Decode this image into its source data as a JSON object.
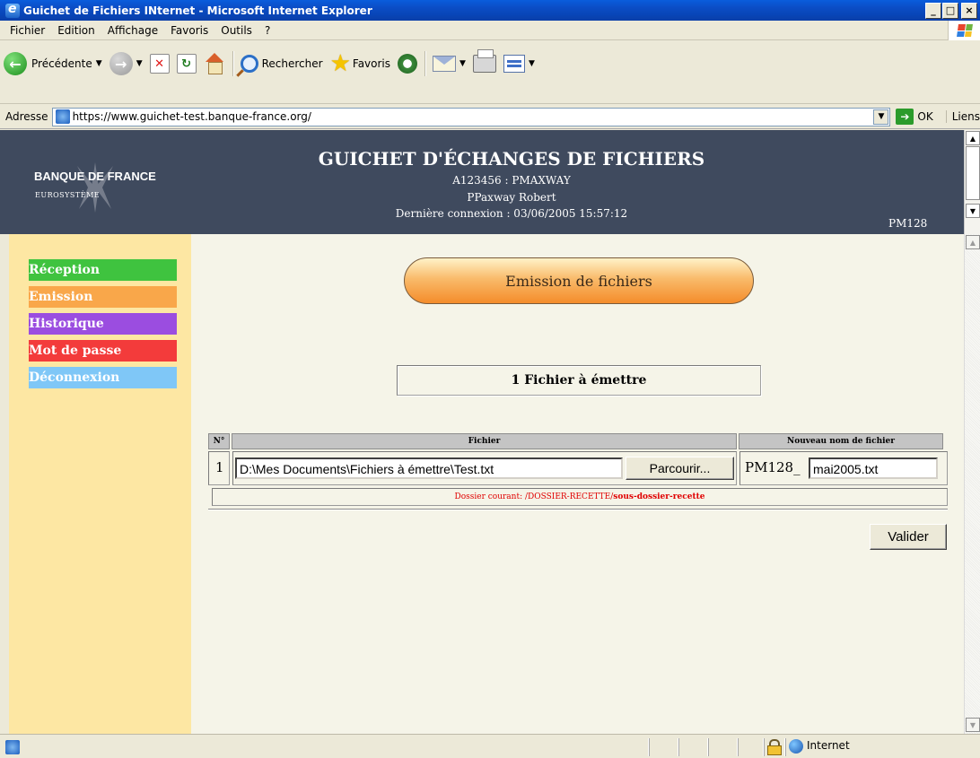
{
  "window": {
    "title": "Guichet de Fichiers INternet - Microsoft Internet Explorer",
    "buttons": {
      "minimize": "_",
      "maximize": "□",
      "close": "×"
    }
  },
  "menu": [
    "Fichier",
    "Edition",
    "Affichage",
    "Favoris",
    "Outils",
    "?"
  ],
  "toolbar": {
    "back_label": "Précédente",
    "search_label": "Rechercher",
    "favorites_label": "Favoris"
  },
  "address": {
    "label": "Adresse",
    "url": "https://www.guichet-test.banque-france.org/",
    "go_label": "OK",
    "links_label": "Liens"
  },
  "header": {
    "logo_name": "BANQUE DE FRANCE",
    "logo_sub": "EUROSYSTÈME",
    "title": "GUICHET D'ÉCHANGES DE FICHIERS",
    "user_id": "A123456 : PMAXWAY",
    "user_name": "PPaxway Robert",
    "last_login": "Dernière connexion : 03/06/2005 15:57:12",
    "code": "PM128"
  },
  "sidebar": {
    "items": [
      {
        "label": "Réception",
        "color": "#3fc33f"
      },
      {
        "label": "Emission",
        "color": "#f9a74a"
      },
      {
        "label": "Historique",
        "color": "#9b4de0"
      },
      {
        "label": "Mot de passe",
        "color": "#f33b3b"
      },
      {
        "label": "Déconnexion",
        "color": "#7fc7f7"
      }
    ]
  },
  "main": {
    "section_title": "Emission de fichiers",
    "count_label": "1 Fichier à émettre",
    "table": {
      "headers": {
        "num": "N°",
        "file": "Fichier",
        "new_name": "Nouveau nom de fichier"
      },
      "rows": [
        {
          "num": "1",
          "file_path": "D:\\Mes Documents\\Fichiers à émettre\\Test.txt",
          "browse_label": "Parcourir...",
          "prefix": "PM128_",
          "new_name": "mai2005.txt"
        }
      ]
    },
    "current_folder_label": "Dossier courant: ",
    "current_folder_path": "/DOSSIER-RECETTE/",
    "current_folder_sub": "sous-dossier-recette",
    "submit_label": "Valider"
  },
  "statusbar": {
    "zone": "Internet"
  }
}
